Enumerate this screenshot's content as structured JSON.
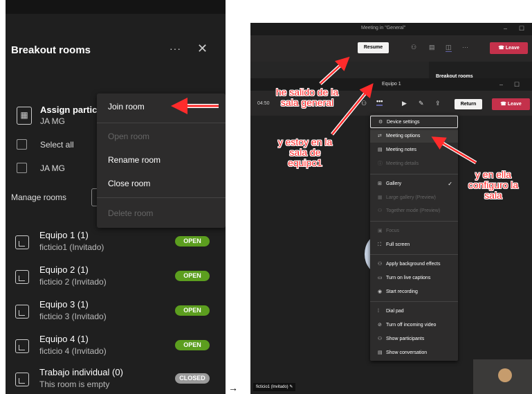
{
  "left": {
    "title": "Breakout rooms",
    "more": "···",
    "close": "✕",
    "assign": {
      "title": "Assign partic",
      "sub": "JA MG"
    },
    "select_all": "Select all",
    "participant": "JA MG",
    "manage": "Manage rooms",
    "context_menu": {
      "join": "Join room",
      "open": "Open room",
      "rename": "Rename room",
      "close": "Close room",
      "delete": "Delete room"
    },
    "rooms": [
      {
        "name": "Equipo 1 (1)",
        "sub": "ficticio1 (Invitado)",
        "status": "OPEN"
      },
      {
        "name": "Equipo 2 (1)",
        "sub": "ficticio 2 (Invitado)",
        "status": "OPEN"
      },
      {
        "name": "Equipo 3 (1)",
        "sub": "ficticio 3 (Invitado)",
        "status": "OPEN"
      },
      {
        "name": "Equipo 4 (1)",
        "sub": "ficticio 4 (Invitado)",
        "status": "OPEN"
      },
      {
        "name": "Trabajo individual (0)",
        "sub": "This room is empty",
        "status": "CLOSED"
      }
    ],
    "open_color": "#5c9e1f",
    "closed_color": "#9a9a9a"
  },
  "arrow_between": "→",
  "right": {
    "window_title": "Meeting in \"General\"",
    "minimize": "–",
    "maximize": "☐",
    "resume": "Resume",
    "leave": "Leave",
    "breakout_peek": "Breakout rooms",
    "room_title": "Equipo 1",
    "time": "04:50",
    "return": "Return",
    "menu": {
      "device_settings": "Device settings",
      "meeting_options": "Meeting options",
      "meeting_notes": "Meeting notes",
      "meeting_details": "Meeting details",
      "gallery": "Gallery",
      "large_gallery": "Large gallery (Preview)",
      "together_mode": "Together mode (Preview)",
      "focus": "Focus",
      "full_screen": "Full screen",
      "background_effects": "Apply background effects",
      "live_captions": "Turn on live captions",
      "start_recording": "Start recording",
      "dial_pad": "Dial pad",
      "turn_off_video": "Turn off incoming video",
      "show_participants": "Show participants",
      "show_conversation": "Show conversation"
    },
    "name_tag": "ficticio1 (Invitado)",
    "leave_color": "#c4314b"
  },
  "annotations": {
    "note1": "he salido de la sala general",
    "note2": "y estoy en la sala de equipo1",
    "note3": "y en ella configuro la sala"
  }
}
